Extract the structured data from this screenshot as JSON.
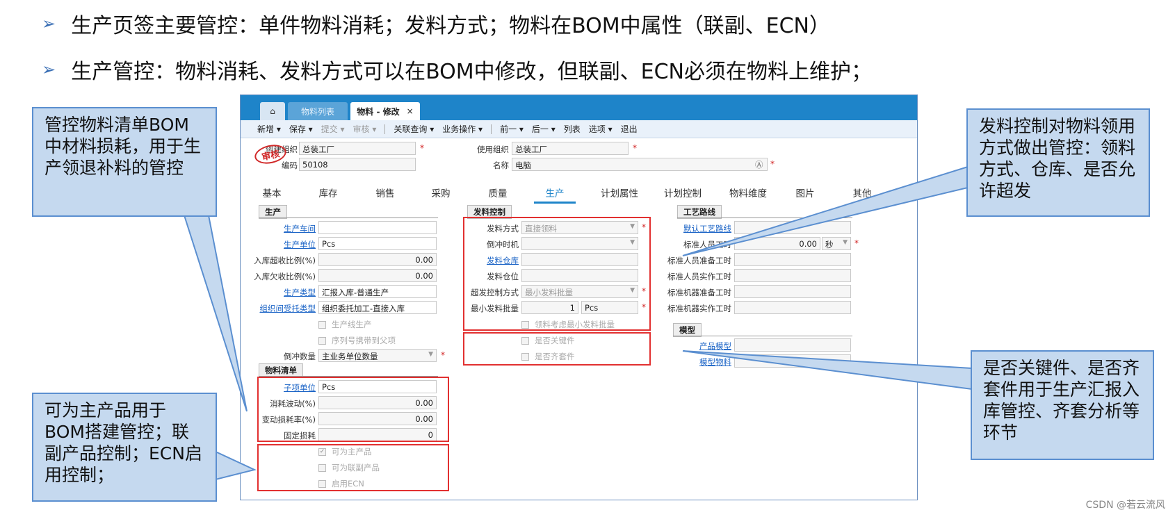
{
  "bullets": [
    "生产页签主要管控：单件物料消耗；发料方式；物料在BOM中属性（联副、ECN）",
    "生产管控：物料消耗、发料方式可以在BOM中修改，但联副、ECN必须在物料上维护；"
  ],
  "arrow_glyph": "➢",
  "tabs": {
    "home": "⌂",
    "list": "物料列表",
    "edit": "物料 - 修改",
    "close": "×"
  },
  "toolbar": [
    "新增 ▾",
    "保存 ▾",
    "提交 ▾",
    "审核 ▾",
    "关联查询 ▾",
    "业务操作 ▾",
    "前一 ▾",
    "后一 ▾",
    "列表",
    "选项 ▾",
    "退出"
  ],
  "header": {
    "create_org_label": "创建组织",
    "create_org": "总装工厂",
    "code_label": "编码",
    "code": "50108",
    "use_org_label": "使用组织",
    "use_org": "总装工厂",
    "name_label": "名称",
    "name": "电脑",
    "stamp": "审核"
  },
  "page_tabs": [
    "基本",
    "库存",
    "销售",
    "采购",
    "质量",
    "生产",
    "计划属性",
    "计划控制",
    "物料维度",
    "图片",
    "其他"
  ],
  "prod": {
    "title": "生产",
    "workshop": "生产车间",
    "unit_label": "生产单位",
    "unit": "Pcs",
    "over_label": "入库超收比例(%)",
    "over": "0.00",
    "under_label": "入库欠收比例(%)",
    "under": "0.00",
    "type_label": "生产类型",
    "type": "汇报入库-普通生产",
    "entrust_label": "组织间受托类型",
    "entrust": "组织委托加工-直接入库",
    "line": "生产线生产",
    "serial": "序列号携带到父项",
    "backflush_label": "倒冲数量",
    "backflush": "主业务单位数量"
  },
  "bom": {
    "title": "物料清单",
    "sub_unit_label": "子项单位",
    "sub_unit": "Pcs",
    "waste_var_label": "消耗波动(%)",
    "waste_var": "0.00",
    "loss_rate_label": "变动损耗率(%)",
    "loss_rate": "0.00",
    "fixed_loss_label": "固定损耗",
    "fixed_loss": "0",
    "main": "可为主产品",
    "byprod": "可为联副产品",
    "ecn": "启用ECN"
  },
  "issue": {
    "title": "发料控制",
    "method_label": "发料方式",
    "method": "直接领料",
    "backflush_time_label": "倒冲时机",
    "warehouse_label": "发料仓库",
    "location_label": "发料仓位",
    "over_ctrl_label": "超发控制方式",
    "over_ctrl": "最小发料批量",
    "min_batch_label": "最小发料批量",
    "min_batch": "1",
    "min_unit": "Pcs",
    "consider": "领料考虑最小发料批量",
    "key": "是否关键件",
    "kit": "是否齐套件"
  },
  "route": {
    "title": "工艺路线",
    "default_route": "默认工艺路线",
    "std_labor": "标准人员工时",
    "std_labor_val": "0.00",
    "std_unit": "秒",
    "prep_labor": "标准人员准备工时",
    "real_labor": "标准人员实作工时",
    "prep_mach": "标准机器准备工时",
    "real_mach": "标准机器实作工时"
  },
  "model": {
    "title": "模型",
    "product_model": "产品模型",
    "model_material": "模型物料"
  },
  "callouts": {
    "tl": "管控物料清单BOM中材料损耗，用于生产领退补料的管控",
    "bl": "可为主产品用于BOM搭建管控；联副产品控制；ECN启用控制；",
    "tr": "发料控制对物料领用方式做出管控：领料方式、仓库、是否允许超发",
    "br": "是否关键件、是否齐套件用于生产汇报入库管控、齐套分析等环节"
  },
  "footer": "CSDN @若云流风"
}
